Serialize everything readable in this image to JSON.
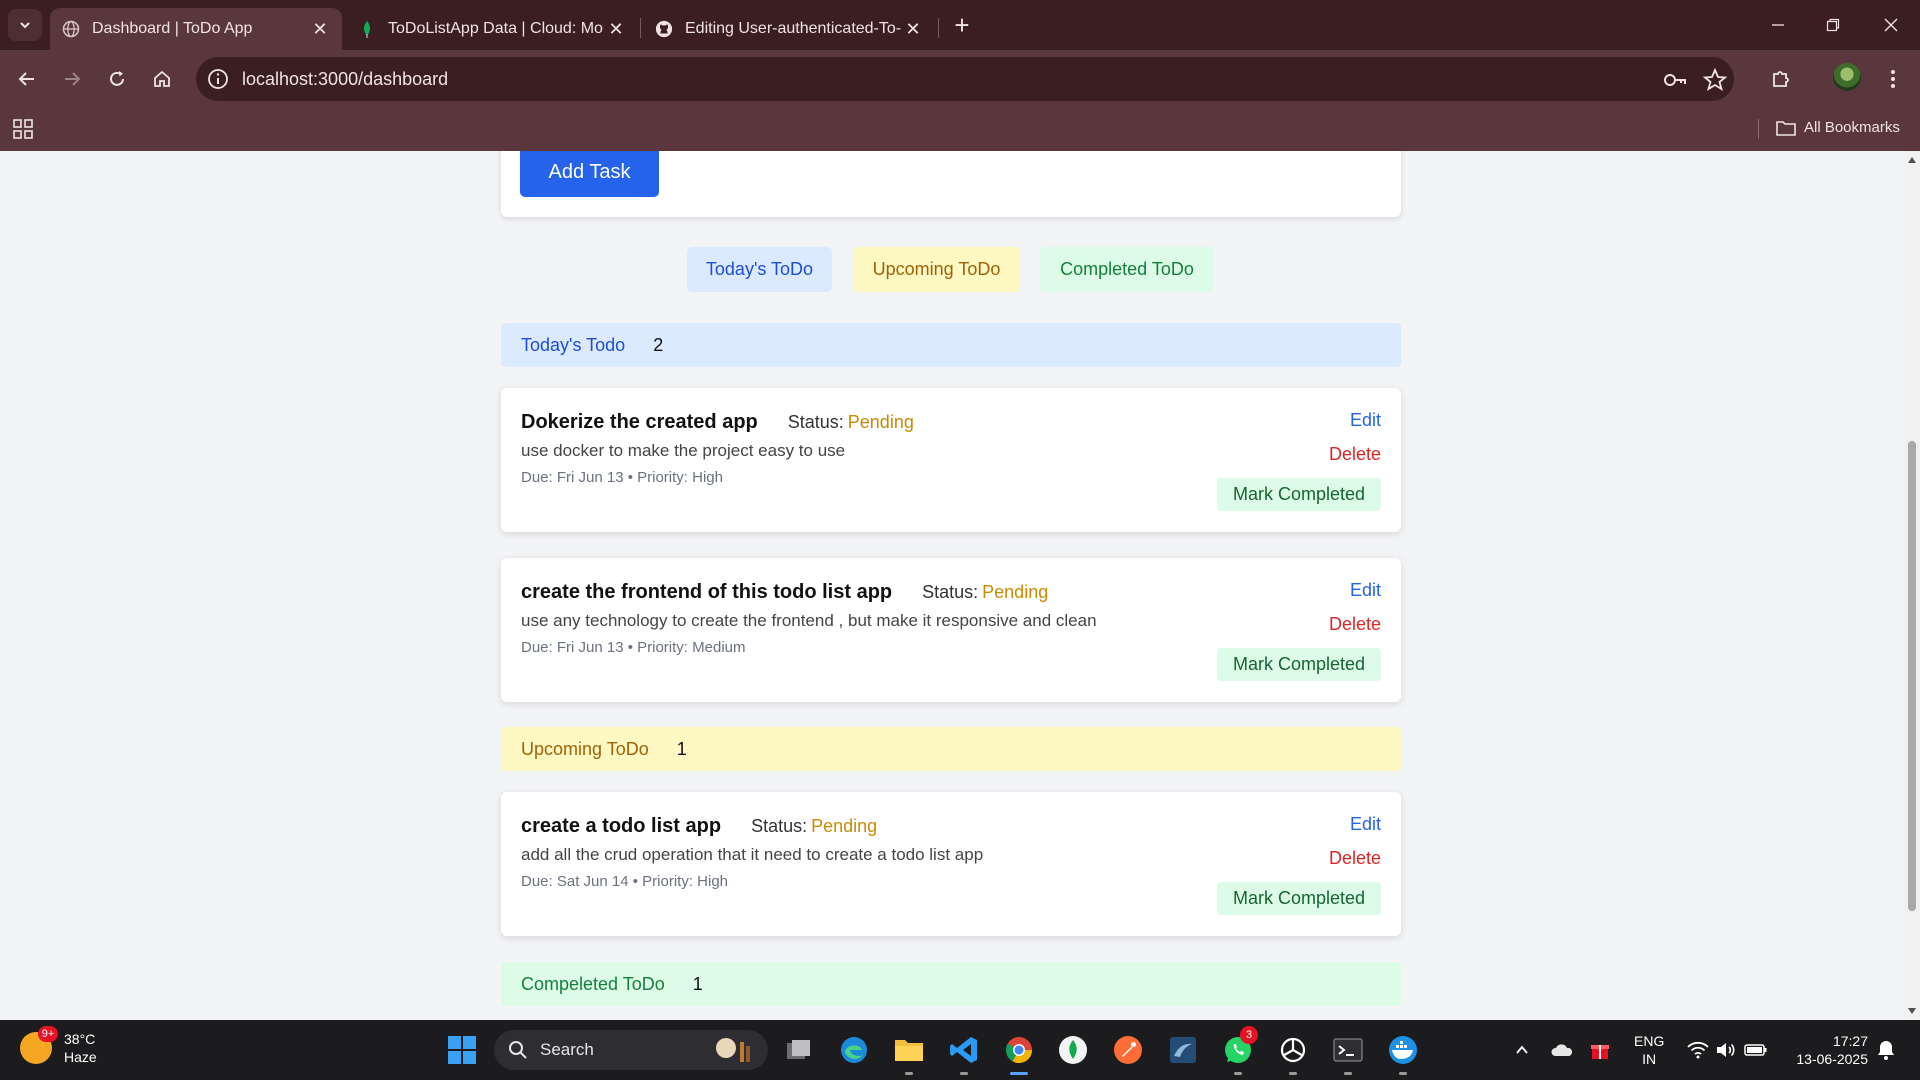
{
  "browser": {
    "tabs": [
      {
        "title": "Dashboard | ToDo App",
        "icon": "globe-icon",
        "active": true
      },
      {
        "title": "ToDoListApp Data | Cloud: Mon",
        "icon": "mongodb-leaf-icon",
        "active": false
      },
      {
        "title": "Editing User-authenticated-To-",
        "icon": "github-icon",
        "active": false
      }
    ],
    "url": "localhost:3000/dashboard",
    "bookmarks_label": "All Bookmarks"
  },
  "page": {
    "add_task_label": "Add Task",
    "filters": {
      "today": "Today's ToDo",
      "upcoming": "Upcoming ToDo",
      "completed": "Completed ToDo"
    },
    "sections": {
      "today": {
        "label": "Today's Todo",
        "count": "2"
      },
      "upcoming": {
        "label": "Upcoming ToDo",
        "count": "1"
      },
      "completed": {
        "label": "Compeleted ToDo",
        "count": "1"
      }
    },
    "status_label": "Status:",
    "edit_label": "Edit",
    "delete_label": "Delete",
    "mark_completed_label": "Mark Completed",
    "tasks": [
      {
        "title": "Dokerize the created app",
        "status": "Pending",
        "description": "use docker to make the project easy to use",
        "meta": "Due: Fri Jun 13 • Priority: High"
      },
      {
        "title": "create the frontend of this todo list app",
        "status": "Pending",
        "description": "use any technology to create the frontend , but make it responsive and clean",
        "meta": "Due: Fri Jun 13 • Priority: Medium"
      },
      {
        "title": "create a todo list app",
        "status": "Pending",
        "description": "add all the crud operation that it need to create a todo list app",
        "meta": "Due: Sat Jun 14 • Priority: High"
      }
    ]
  },
  "taskbar": {
    "weather": {
      "temp": "38°C",
      "condition": "Haze",
      "badge": "9+"
    },
    "search_label": "Search",
    "whatsapp_badge": "3",
    "language": {
      "line1": "ENG",
      "line2": "IN"
    },
    "clock": {
      "time": "17:27",
      "date": "13-06-2025"
    }
  },
  "colors": {
    "chrome_dark": "#3a1e22",
    "chrome": "#5a373c",
    "primary": "#2563eb",
    "pending": "#ca8a04",
    "danger": "#dc2626",
    "success_bg": "#dcfce7"
  }
}
